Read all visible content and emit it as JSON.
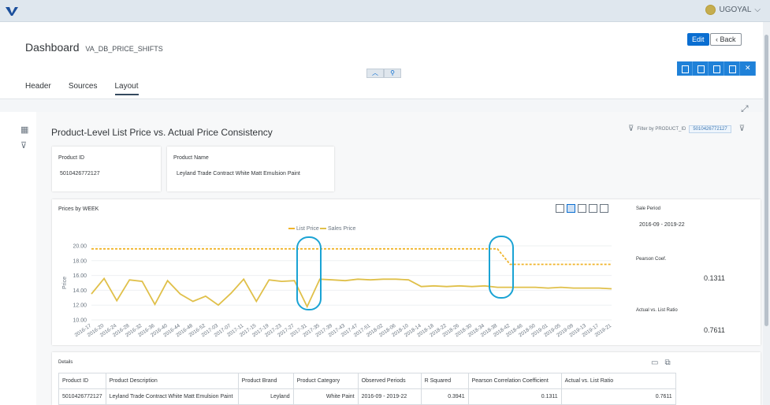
{
  "shell": {
    "user_name": "UGOYAL"
  },
  "header": {
    "title": "Dashboard",
    "subtitle": "VA_DB_PRICE_SHIFTS",
    "edit_label": "Edit",
    "back_label": "Back",
    "tabs": [
      {
        "label": "Header"
      },
      {
        "label": "Sources"
      },
      {
        "label": "Layout"
      }
    ],
    "active_tab": "Layout"
  },
  "content": {
    "title": "Product-Level List Price vs. Actual Price Consistency",
    "filter_label": "Filter by PRODUCT_ID",
    "filter_value": "5010426772127"
  },
  "product_card": {
    "id_label": "Product ID",
    "id_value": "5010426772127",
    "name_label": "Product Name",
    "name_value": "Leyland Trade Contract White Matt Emulsion Paint"
  },
  "kpis": {
    "sale_period_label": "Sale Period",
    "sale_period_value": "2016-09 - 2019-22",
    "pearson_label": "Pearson Coef.",
    "pearson_value": "0.1311",
    "ratio_label": "Actual vs. List Ratio",
    "ratio_value": "0.7611"
  },
  "chart_data": {
    "type": "line",
    "title": "Prices by WEEK",
    "ylabel": "Price",
    "ylim": [
      10,
      20
    ],
    "yticks": [
      "20.00",
      "18.00",
      "16.00",
      "14.00",
      "12.00",
      "10.00"
    ],
    "legend_position": "top",
    "xticks": [
      "2016-17",
      "2016-20",
      "2016-24",
      "2016-28",
      "2016-32",
      "2016-36",
      "2016-40",
      "2016-44",
      "2016-48",
      "2016-52",
      "2017-03",
      "2017-07",
      "2017-11",
      "2017-15",
      "2017-19",
      "2017-23",
      "2017-27",
      "2017-31",
      "2017-35",
      "2017-39",
      "2017-43",
      "2017-47",
      "2017-51",
      "2018-02",
      "2018-06",
      "2018-10",
      "2018-14",
      "2018-18",
      "2018-22",
      "2018-26",
      "2018-30",
      "2018-34",
      "2018-38",
      "2018-42",
      "2018-46",
      "2018-50",
      "2019-01",
      "2019-05",
      "2019-09",
      "2019-13",
      "2019-17",
      "2019-21"
    ],
    "series": [
      {
        "name": "List Price",
        "color": "#f0b429",
        "dashed": true,
        "values": [
          19.6,
          19.6,
          19.6,
          19.6,
          19.6,
          19.6,
          19.6,
          19.6,
          19.6,
          19.6,
          19.6,
          19.6,
          19.6,
          19.6,
          19.6,
          19.6,
          19.6,
          19.6,
          19.6,
          19.6,
          19.6,
          19.6,
          19.6,
          19.6,
          19.6,
          19.6,
          19.6,
          19.6,
          19.6,
          19.6,
          19.6,
          19.6,
          19.6,
          17.5,
          17.5,
          17.5,
          17.5,
          17.5,
          17.5,
          17.5,
          17.5,
          17.5
        ]
      },
      {
        "name": "Sales Price",
        "color": "#e0c04a",
        "dashed": false,
        "values": [
          13.5,
          15.6,
          12.6,
          15.4,
          15.2,
          12.1,
          15.3,
          13.5,
          12.5,
          13.2,
          12.0,
          13.6,
          15.5,
          12.5,
          15.4,
          15.2,
          15.3,
          11.8,
          15.5,
          15.4,
          15.3,
          15.5,
          15.4,
          15.5,
          15.5,
          15.4,
          14.5,
          14.6,
          14.5,
          14.6,
          14.5,
          14.6,
          14.4,
          14.4,
          14.4,
          14.4,
          14.3,
          14.4,
          14.3,
          14.3,
          14.3,
          14.2
        ]
      }
    ]
  },
  "details": {
    "title": "Details",
    "columns": [
      "Product ID",
      "Product Description",
      "Product Brand",
      "Product Category",
      "Observed Periods",
      "R Squared",
      "Pearson Correlation Coefficient",
      "Actual vs. List Ratio"
    ],
    "rows": [
      [
        "5010426772127",
        "Leyland Trade Contract White Matt Emulsion Paint",
        "Leyland",
        "White Paint",
        "2016-09 - 2019-22",
        "0.3941",
        "0.1311",
        "0.7611"
      ]
    ]
  }
}
